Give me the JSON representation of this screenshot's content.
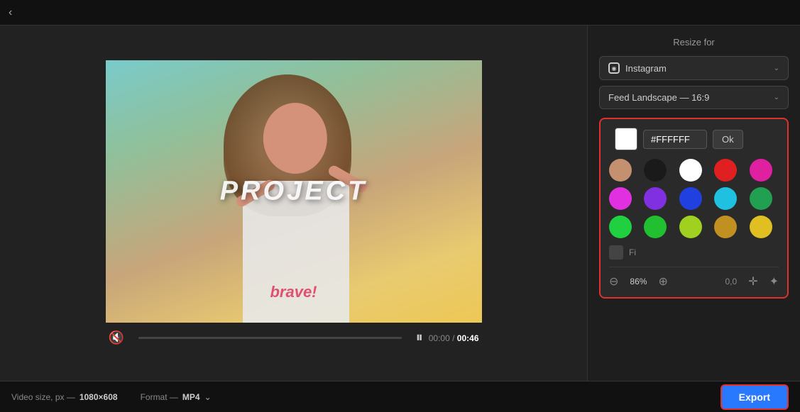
{
  "topbar": {
    "back_label": "‹"
  },
  "video": {
    "project_text": "PROJECT",
    "brave_text": "brave!",
    "time_current": "00:00",
    "time_total": "00:46",
    "play_icon": "⏸",
    "mute_icon": "🔇",
    "progress_percent": 0
  },
  "right_panel": {
    "resize_label": "Resize for",
    "platform_dropdown": {
      "label": "Instagram",
      "icon": "instagram"
    },
    "format_dropdown": {
      "label": "Feed Landscape — 16:9"
    },
    "color_picker": {
      "hex_value": "#FFFFFF",
      "ok_label": "Ok",
      "colors": [
        {
          "name": "skin",
          "hex": "#c49070"
        },
        {
          "name": "black",
          "hex": "#1a1a1a"
        },
        {
          "name": "white",
          "hex": "#ffffff"
        },
        {
          "name": "red",
          "hex": "#e02020"
        },
        {
          "name": "pink",
          "hex": "#e020a0"
        },
        {
          "name": "magenta",
          "hex": "#e030e0"
        },
        {
          "name": "purple",
          "hex": "#8030e0"
        },
        {
          "name": "blue",
          "hex": "#2040e0"
        },
        {
          "name": "cyan",
          "hex": "#20c0e0"
        },
        {
          "name": "dark-green",
          "hex": "#20a050"
        },
        {
          "name": "green1",
          "hex": "#20d040"
        },
        {
          "name": "green2",
          "hex": "#20c030"
        },
        {
          "name": "yellow-green",
          "hex": "#a0d020"
        },
        {
          "name": "gold",
          "hex": "#c09020"
        },
        {
          "name": "yellow",
          "hex": "#e0c020"
        }
      ],
      "fill_label": "Fi"
    },
    "tools": {
      "zoom_out": "⊖",
      "zoom_pct": "86%",
      "zoom_in": "⊕",
      "coordinates": "0,0",
      "move_icon": "✛",
      "magic_icon": "✦"
    }
  },
  "bottom_bar": {
    "video_size_label": "Video size, px —",
    "video_size_value": "1080×608",
    "format_label": "Format —",
    "format_value": "MP4",
    "export_label": "Export"
  }
}
